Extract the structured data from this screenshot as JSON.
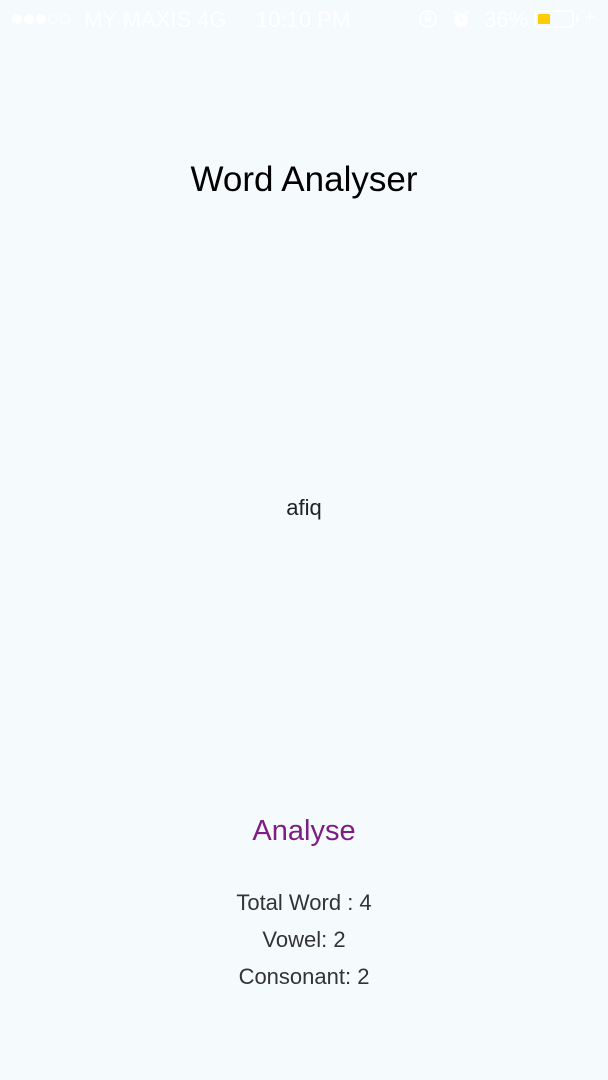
{
  "status_bar": {
    "carrier": "MY MAXIS  4G",
    "time": "10:10 PM",
    "battery_percent": "36%",
    "battery_level": 0.36,
    "signal_bars_filled": 3,
    "signal_bars_total": 5,
    "icons": [
      "orientation-lock-icon",
      "alarm-icon",
      "battery-icon",
      "charging-icon"
    ],
    "battery_color": "#ffcc00"
  },
  "app": {
    "title": "Word Analyser",
    "word_input": {
      "value": "afiq",
      "placeholder": ""
    },
    "analyse_button_label": "Analyse",
    "results": {
      "total_word": "Total Word : 4",
      "vowel": "Vowel: 2",
      "consonant": "Consonant: 2"
    }
  },
  "colors": {
    "background": "#f5fbfd",
    "accent": "#7f1e82"
  }
}
